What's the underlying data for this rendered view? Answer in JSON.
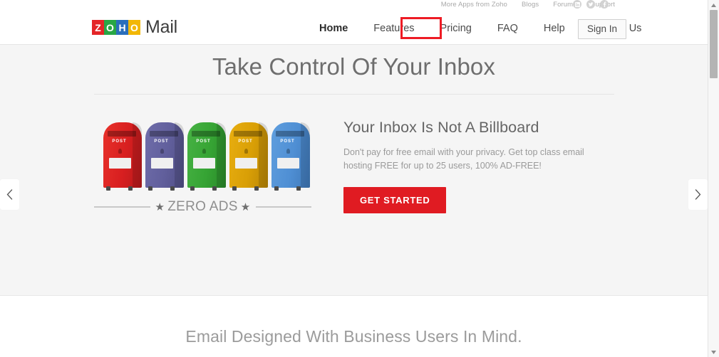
{
  "topbar": {
    "links": [
      {
        "label": "More Apps from Zoho"
      },
      {
        "label": "Blogs"
      },
      {
        "label": "Forums"
      },
      {
        "label": "Support"
      }
    ],
    "social": [
      {
        "name": "linkedin-icon"
      },
      {
        "name": "twitter-icon"
      },
      {
        "name": "facebook-icon"
      }
    ]
  },
  "header": {
    "logo": {
      "tiles": [
        "Z",
        "O",
        "H",
        "O"
      ],
      "tile_colors": [
        "#e42527",
        "#28a745",
        "#2a6ebb",
        "#f2b705"
      ],
      "word": "Mail"
    },
    "nav": [
      {
        "label": "Home",
        "active": true,
        "highlighted": false
      },
      {
        "label": "Features",
        "active": false,
        "highlighted": false
      },
      {
        "label": "Pricing",
        "active": false,
        "highlighted": true
      },
      {
        "label": "FAQ",
        "active": false,
        "highlighted": false
      },
      {
        "label": "Help",
        "active": false,
        "highlighted": false
      },
      {
        "label": "Contact Us",
        "active": false,
        "highlighted": false
      }
    ],
    "signin_label": "Sign In",
    "highlight_color": "#ee1b24"
  },
  "hero": {
    "title": "Take Control Of Your Inbox",
    "slide": {
      "heading": "Your Inbox Is Not A Billboard",
      "paragraph": "Don't pay for free email with your privacy. Get top class email hosting FREE for up to 25 users, 100% AD-FREE!",
      "cta_label": "GET STARTED",
      "cta_color": "#e01b22"
    },
    "illustration": {
      "mailbox_label": "POST",
      "mailboxes": [
        {
          "color": "#d81f20",
          "name": "red"
        },
        {
          "color": "#615f9c",
          "name": "purple"
        },
        {
          "color": "#36a434",
          "name": "green"
        },
        {
          "color": "#d99f06",
          "name": "yellow"
        },
        {
          "color": "#4f8fd4",
          "name": "blue"
        }
      ],
      "caption_star_left": "★",
      "caption": "ZERO  ADS",
      "caption_star_right": "★"
    },
    "prev_label": "‹",
    "next_label": "›"
  },
  "lower": {
    "heading": "Email Designed With Business Users In Mind."
  },
  "scrollbar": {
    "up_label": "▲",
    "down_label": "▼"
  }
}
